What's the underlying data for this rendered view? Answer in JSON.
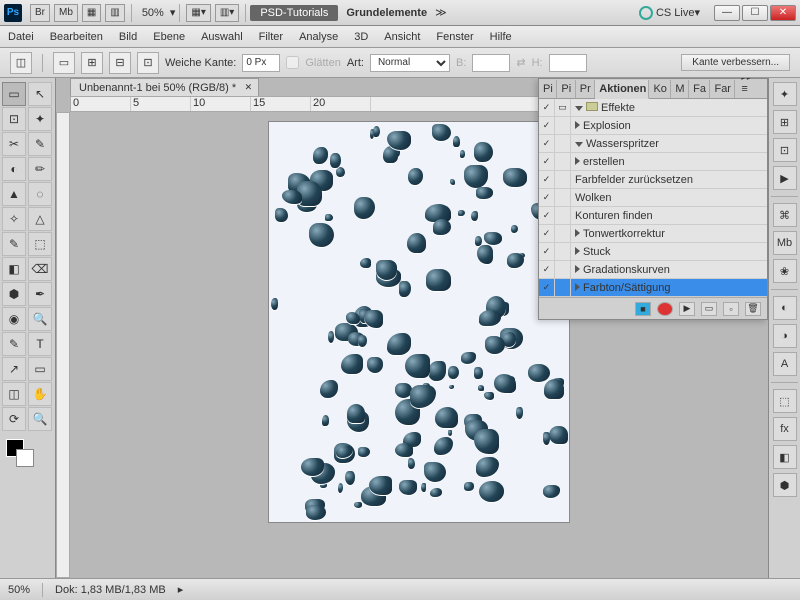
{
  "title": {
    "doc": "PSD-Tutorials",
    "sub": "Grundelemente",
    "cslive": "CS Live"
  },
  "zoom": "50%",
  "menu": [
    "Datei",
    "Bearbeiten",
    "Bild",
    "Ebene",
    "Auswahl",
    "Filter",
    "Analyse",
    "3D",
    "Ansicht",
    "Fenster",
    "Hilfe"
  ],
  "options": {
    "weiche": "Weiche Kante:",
    "weiche_val": "0 Px",
    "glatten": "Glätten",
    "art": "Art:",
    "art_val": "Normal",
    "b": "B:",
    "h": "H:",
    "verbessern": "Kante verbessern..."
  },
  "doc_tab": "Unbenannt-1 bei 50% (RGB/8) *",
  "ruler_marks": [
    "0",
    "5",
    "10",
    "15",
    "20"
  ],
  "panel": {
    "tabs_left": [
      "Pi",
      "Pi",
      "Pr"
    ],
    "active": "Aktionen",
    "tabs_right": [
      "Ko",
      "M",
      "Fa",
      "Far"
    ],
    "root": "Effekte",
    "rows": [
      {
        "chk": true,
        "mode": true,
        "lvl": 0,
        "exp": true,
        "folder": true,
        "label": "Effekte"
      },
      {
        "chk": true,
        "mode": false,
        "lvl": 1,
        "exp": false,
        "label": "Explosion"
      },
      {
        "chk": true,
        "mode": false,
        "lvl": 1,
        "exp": true,
        "label": "Wasserspritzer"
      },
      {
        "chk": true,
        "mode": false,
        "lvl": 2,
        "exp": false,
        "label": "erstellen"
      },
      {
        "chk": true,
        "mode": false,
        "lvl": 2,
        "label": "Farbfelder zurücksetzen"
      },
      {
        "chk": true,
        "mode": false,
        "lvl": 2,
        "label": "Wolken"
      },
      {
        "chk": true,
        "mode": false,
        "lvl": 2,
        "label": "Konturen finden"
      },
      {
        "chk": true,
        "mode": false,
        "lvl": 2,
        "exp": false,
        "label": "Tonwertkorrektur"
      },
      {
        "chk": true,
        "mode": false,
        "lvl": 2,
        "exp": false,
        "label": "Stuck"
      },
      {
        "chk": true,
        "mode": false,
        "lvl": 2,
        "exp": false,
        "label": "Gradationskurven"
      },
      {
        "chk": true,
        "mode": false,
        "lvl": 2,
        "exp": false,
        "label": "Farbton/Sättigung",
        "sel": true
      }
    ]
  },
  "status": {
    "zoom": "50%",
    "dok": "Dok: 1,83 MB/1,83 MB"
  },
  "tb_icons": [
    "Br",
    "Mb",
    "▦",
    "▥"
  ],
  "right_dock": [
    "✦",
    "⊞",
    "⊡",
    "▶",
    "⌘",
    "Mb",
    "❀",
    "◐",
    "◑",
    "A",
    "⬚",
    "fx",
    "◧",
    "⬢"
  ]
}
